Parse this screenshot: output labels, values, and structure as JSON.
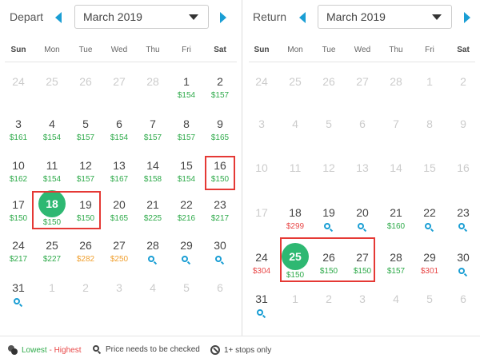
{
  "depart": {
    "label": "Depart",
    "month": "March 2019",
    "weekdays": [
      "Sun",
      "Mon",
      "Tue",
      "Wed",
      "Thu",
      "Fri",
      "Sat"
    ],
    "weeks": [
      [
        {
          "d": "24",
          "o": 1
        },
        {
          "d": "25",
          "o": 1
        },
        {
          "d": "26",
          "o": 1
        },
        {
          "d": "27",
          "o": 1
        },
        {
          "d": "28",
          "o": 1
        },
        {
          "d": "1",
          "p": "$154",
          "c": "green"
        },
        {
          "d": "2",
          "p": "$157",
          "c": "green"
        }
      ],
      [
        {
          "d": "3",
          "p": "$161",
          "c": "green"
        },
        {
          "d": "4",
          "p": "$154",
          "c": "green"
        },
        {
          "d": "5",
          "p": "$157",
          "c": "green"
        },
        {
          "d": "6",
          "p": "$154",
          "c": "green"
        },
        {
          "d": "7",
          "p": "$157",
          "c": "green"
        },
        {
          "d": "8",
          "p": "$157",
          "c": "green"
        },
        {
          "d": "9",
          "p": "$165",
          "c": "green"
        }
      ],
      [
        {
          "d": "10",
          "p": "$162",
          "c": "green"
        },
        {
          "d": "11",
          "p": "$154",
          "c": "green"
        },
        {
          "d": "12",
          "p": "$157",
          "c": "green"
        },
        {
          "d": "13",
          "p": "$167",
          "c": "green"
        },
        {
          "d": "14",
          "p": "$158",
          "c": "green"
        },
        {
          "d": "15",
          "p": "$154",
          "c": "green"
        },
        {
          "d": "16",
          "p": "$150",
          "c": "green"
        }
      ],
      [
        {
          "d": "17",
          "p": "$150",
          "c": "green"
        },
        {
          "d": "18",
          "p": "$150",
          "c": "green",
          "s": 1
        },
        {
          "d": "19",
          "p": "$150",
          "c": "green"
        },
        {
          "d": "20",
          "p": "$165",
          "c": "green"
        },
        {
          "d": "21",
          "p": "$225",
          "c": "green"
        },
        {
          "d": "22",
          "p": "$216",
          "c": "green"
        },
        {
          "d": "23",
          "p": "$217",
          "c": "green"
        }
      ],
      [
        {
          "d": "24",
          "p": "$217",
          "c": "green"
        },
        {
          "d": "25",
          "p": "$227",
          "c": "green"
        },
        {
          "d": "26",
          "p": "$282",
          "c": "orange"
        },
        {
          "d": "27",
          "p": "$250",
          "c": "orange"
        },
        {
          "d": "28",
          "m": 1
        },
        {
          "d": "29",
          "m": 1
        },
        {
          "d": "30",
          "m": 1
        }
      ],
      [
        {
          "d": "31",
          "m": 1
        },
        {
          "d": "1",
          "o": 1
        },
        {
          "d": "2",
          "o": 1
        },
        {
          "d": "3",
          "o": 1
        },
        {
          "d": "4",
          "o": 1
        },
        {
          "d": "5",
          "o": 1
        },
        {
          "d": "6",
          "o": 1
        }
      ]
    ]
  },
  "return": {
    "label": "Return",
    "month": "March 2019",
    "weekdays": [
      "Sun",
      "Mon",
      "Tue",
      "Wed",
      "Thu",
      "Fri",
      "Sat"
    ],
    "weeks": [
      [
        {
          "d": "24",
          "o": 1
        },
        {
          "d": "25",
          "o": 1
        },
        {
          "d": "26",
          "o": 1
        },
        {
          "d": "27",
          "o": 1
        },
        {
          "d": "28",
          "o": 1
        },
        {
          "d": "1",
          "o": 1
        },
        {
          "d": "2",
          "o": 1
        }
      ],
      [
        {
          "d": "3",
          "o": 1
        },
        {
          "d": "4",
          "o": 1
        },
        {
          "d": "5",
          "o": 1
        },
        {
          "d": "6",
          "o": 1
        },
        {
          "d": "7",
          "o": 1
        },
        {
          "d": "8",
          "o": 1
        },
        {
          "d": "9",
          "o": 1
        }
      ],
      [
        {
          "d": "10",
          "o": 1
        },
        {
          "d": "11",
          "o": 1
        },
        {
          "d": "12",
          "o": 1
        },
        {
          "d": "13",
          "o": 1
        },
        {
          "d": "14",
          "o": 1
        },
        {
          "d": "15",
          "o": 1
        },
        {
          "d": "16",
          "o": 1
        }
      ],
      [
        {
          "d": "17",
          "o": 1
        },
        {
          "d": "18",
          "p": "$299",
          "c": "red"
        },
        {
          "d": "19",
          "m": 1
        },
        {
          "d": "20",
          "m": 1
        },
        {
          "d": "21",
          "p": "$160",
          "c": "green"
        },
        {
          "d": "22",
          "m": 1
        },
        {
          "d": "23",
          "m": 1
        }
      ],
      [
        {
          "d": "24",
          "p": "$304",
          "c": "red"
        },
        {
          "d": "25",
          "p": "$150",
          "c": "green",
          "s": 1
        },
        {
          "d": "26",
          "p": "$150",
          "c": "green"
        },
        {
          "d": "27",
          "p": "$150",
          "c": "green"
        },
        {
          "d": "28",
          "p": "$157",
          "c": "green"
        },
        {
          "d": "29",
          "p": "$301",
          "c": "red"
        },
        {
          "d": "30",
          "m": 1
        }
      ],
      [
        {
          "d": "31",
          "m": 1
        },
        {
          "d": "1",
          "o": 1
        },
        {
          "d": "2",
          "o": 1
        },
        {
          "d": "3",
          "o": 1
        },
        {
          "d": "4",
          "o": 1
        },
        {
          "d": "5",
          "o": 1
        },
        {
          "d": "6",
          "o": 1
        }
      ]
    ]
  },
  "legend": {
    "lowest": "Lowest",
    "sep": " - ",
    "highest": "Highest",
    "check": "Price needs to be checked",
    "stops": "1+ stops only"
  },
  "colors": {
    "accent": "#1a9ed4",
    "selected": "#2eb872",
    "low": "#2eaa4a",
    "mid": "#f0a030",
    "high": "#e84848",
    "highlight": "#e53935"
  },
  "icons": {
    "prev": "chevron-left-icon",
    "next": "chevron-right-icon",
    "check": "search-icon",
    "stops": "ban-icon",
    "legend": "price-range-icon"
  }
}
